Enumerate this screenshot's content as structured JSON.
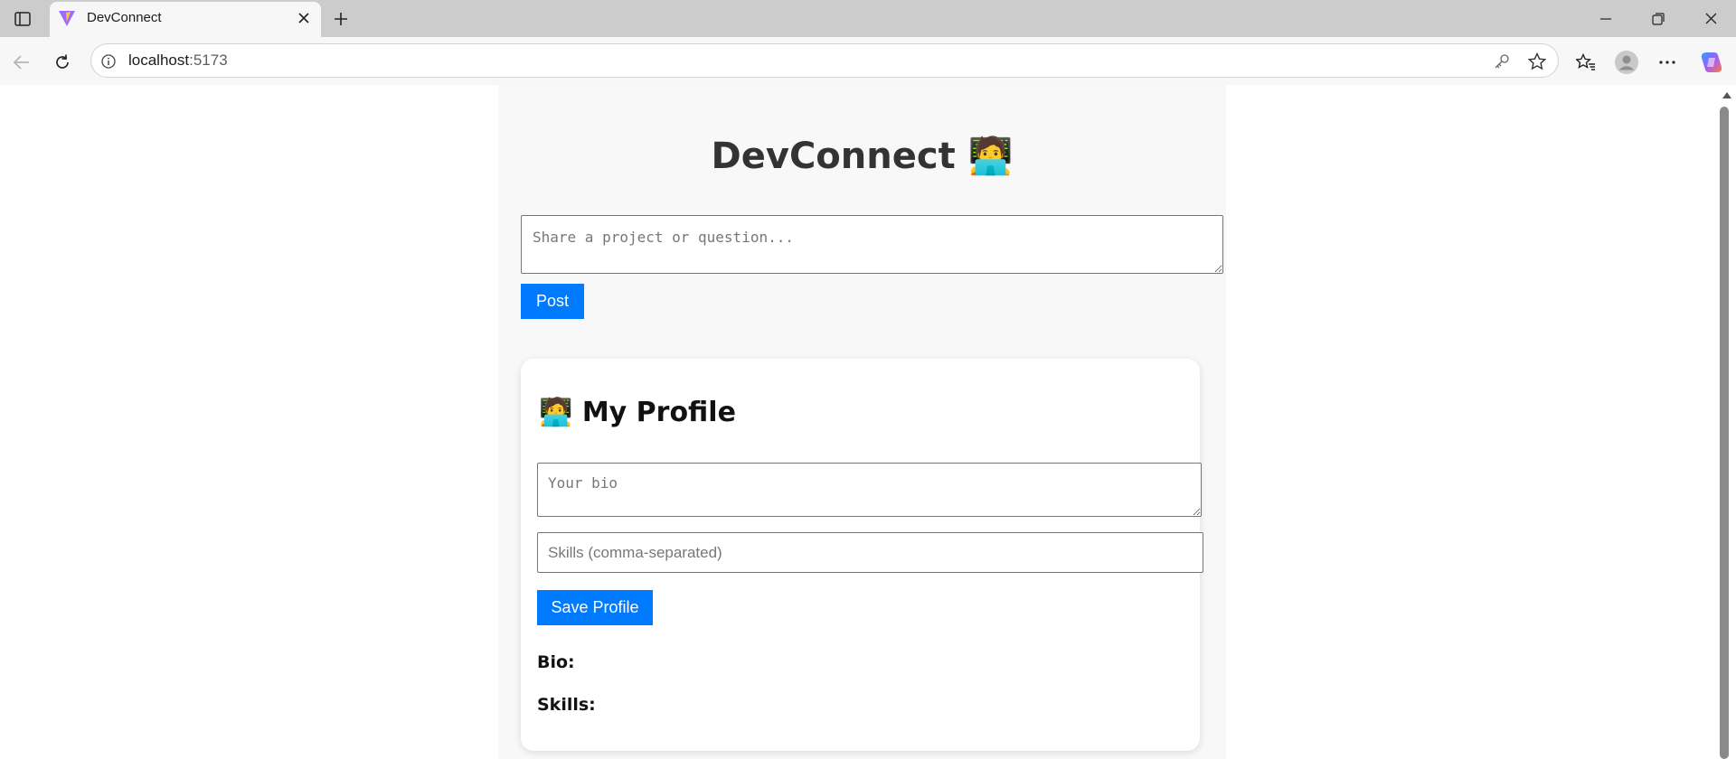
{
  "browser": {
    "tab_title": "DevConnect",
    "url_host": "localhost",
    "url_port": ":5173",
    "icons": [
      "tab-actions-icon",
      "vite-favicon",
      "close-icon",
      "plus-icon",
      "minimize-icon",
      "restore-icon",
      "window-close-icon",
      "back-icon",
      "refresh-icon",
      "info-icon",
      "key-icon",
      "star-icon",
      "favorites-icon",
      "profile-icon",
      "more-icon",
      "copilot-icon"
    ]
  },
  "app": {
    "title": "DevConnect",
    "title_emoji": "🧑‍💻",
    "post": {
      "placeholder": "Share a project or question...",
      "button_label": "Post"
    },
    "profile": {
      "heading_emoji": "🧑‍💻",
      "heading": "My Profile",
      "bio_placeholder": "Your bio",
      "skills_placeholder": "Skills (comma-separated)",
      "save_label": "Save Profile",
      "bio_label": "Bio:",
      "skills_label": "Skills:"
    }
  },
  "colors": {
    "primary": "#007bff",
    "app_background": "#f8f8f8",
    "title_text": "#333333"
  }
}
